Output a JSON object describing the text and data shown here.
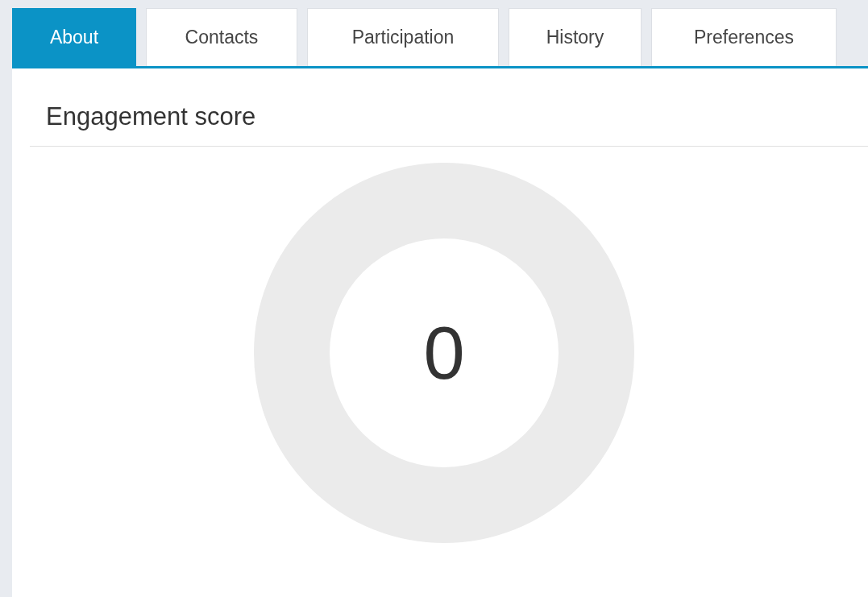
{
  "tabs": [
    {
      "label": "About",
      "selected": true
    },
    {
      "label": "Contacts",
      "selected": false
    },
    {
      "label": "Participation",
      "selected": false
    },
    {
      "label": "History",
      "selected": false
    },
    {
      "label": "Preferences",
      "selected": false
    }
  ],
  "section": {
    "title": "Engagement score"
  },
  "score": {
    "value": "0"
  }
}
